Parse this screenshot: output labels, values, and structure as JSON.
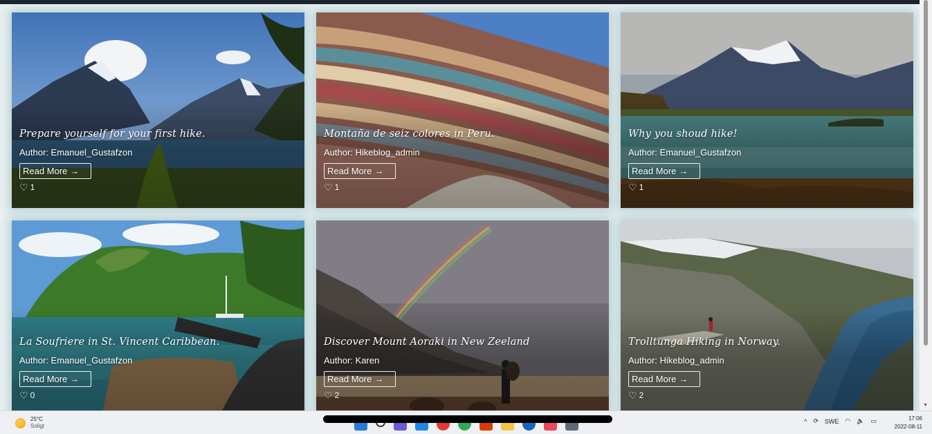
{
  "cards": [
    {
      "title": "Prepare yourself for your first hike.",
      "author": "Author: Emanuel_Gustafzon",
      "read_more": "Read More",
      "likes": "1"
    },
    {
      "title": "Montaña de seiz colores in Peru.",
      "author": "Author: Hikeblog_admin",
      "read_more": "Read More",
      "likes": "1"
    },
    {
      "title": "Why you shoud hike!",
      "author": "Author: Emanuel_Gustafzon",
      "read_more": "Read More",
      "likes": "1"
    },
    {
      "title": "La Soufriere in St. Vincent Caribbean.",
      "author": "Author: Emanuel_Gustafzon",
      "read_more": "Read More",
      "likes": "0"
    },
    {
      "title": "Discover Mount Aoraki in New Zeeland",
      "author": "Author: Karen",
      "read_more": "Read More",
      "likes": "2"
    },
    {
      "title": "Trolltunga Hiking in Norway.",
      "author": "Author: Hikeblog_admin",
      "read_more": "Read More",
      "likes": "2"
    }
  ],
  "read_more_arrow": "→",
  "heart_glyph": "♡",
  "taskbar": {
    "weather_temp": "25°C",
    "weather_condition": "Soligt",
    "language": "SWE",
    "time": "17:06",
    "date": "2022-08-11"
  }
}
